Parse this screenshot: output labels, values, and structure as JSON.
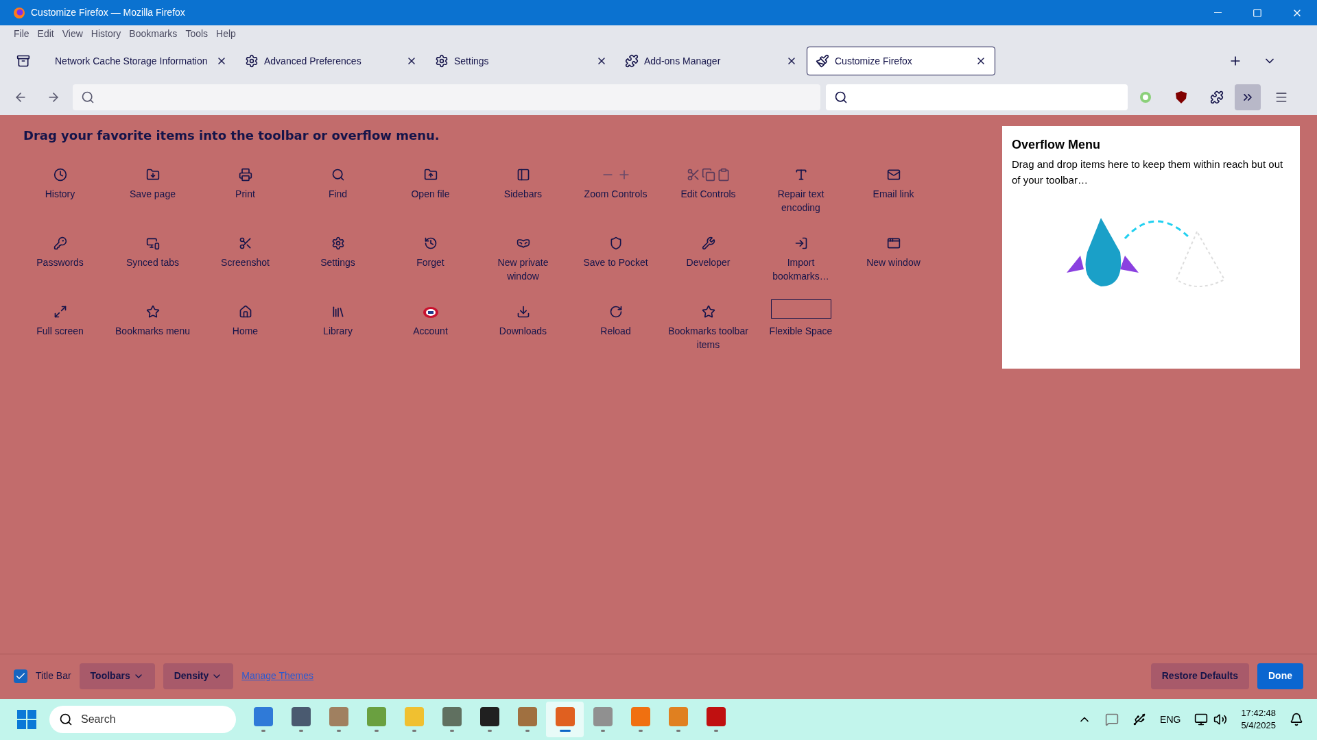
{
  "window": {
    "title": "Customize Firefox — Mozilla Firefox"
  },
  "menu": [
    "File",
    "Edit",
    "View",
    "History",
    "Bookmarks",
    "Tools",
    "Help"
  ],
  "tabs": [
    {
      "label": "Network Cache Storage Information",
      "selected": false
    },
    {
      "label": "Advanced Preferences",
      "selected": false
    },
    {
      "label": "Settings",
      "selected": false
    },
    {
      "label": "Add-ons Manager",
      "selected": false
    },
    {
      "label": "Customize Firefox",
      "selected": true
    }
  ],
  "customize": {
    "heading": "Drag your favorite items into the toolbar or overflow menu.",
    "items": [
      {
        "label": "History",
        "kind": "icon"
      },
      {
        "label": "Save page",
        "kind": "icon"
      },
      {
        "label": "Print",
        "kind": "icon"
      },
      {
        "label": "Find",
        "kind": "icon"
      },
      {
        "label": "Open file",
        "kind": "icon"
      },
      {
        "label": "Sidebars",
        "kind": "icon"
      },
      {
        "label": "Zoom Controls",
        "kind": "icon"
      },
      {
        "label": "Edit Controls",
        "kind": "icon"
      },
      {
        "label": "Repair text encoding",
        "kind": "icon"
      },
      {
        "label": "Email link",
        "kind": "icon"
      },
      {
        "label": "Passwords",
        "kind": "icon"
      },
      {
        "label": "Synced tabs",
        "kind": "icon"
      },
      {
        "label": "Screenshot",
        "kind": "icon"
      },
      {
        "label": "Settings",
        "kind": "icon"
      },
      {
        "label": "Forget",
        "kind": "icon"
      },
      {
        "label": "New private window",
        "kind": "icon"
      },
      {
        "label": "Save to Pocket",
        "kind": "icon"
      },
      {
        "label": "Developer",
        "kind": "icon"
      },
      {
        "label": "Import bookmarks…",
        "kind": "icon"
      },
      {
        "label": "New window",
        "kind": "icon"
      },
      {
        "label": "Full screen",
        "kind": "icon"
      },
      {
        "label": "Bookmarks menu",
        "kind": "icon"
      },
      {
        "label": "Home",
        "kind": "icon"
      },
      {
        "label": "Library",
        "kind": "icon"
      },
      {
        "label": "Account",
        "kind": "icon"
      },
      {
        "label": "Downloads",
        "kind": "icon"
      },
      {
        "label": "Reload",
        "kind": "icon"
      },
      {
        "label": "Bookmarks toolbar items",
        "kind": "icon"
      },
      {
        "label": "Flexible Space",
        "kind": "space"
      }
    ]
  },
  "overflow": {
    "title": "Overflow Menu",
    "text": "Drag and drop items here to keep them within reach but out of your toolbar…"
  },
  "footer": {
    "title_bar": {
      "label": "Title Bar",
      "checked": true
    },
    "toolbars": "Toolbars",
    "density": "Density",
    "manage_themes": "Manage Themes",
    "restore": "Restore Defaults",
    "done": "Done"
  },
  "taskbar": {
    "search_placeholder": "Search",
    "apps": [
      {
        "active": false
      },
      {
        "active": false
      },
      {
        "active": false
      },
      {
        "active": false
      },
      {
        "active": false
      },
      {
        "active": false
      },
      {
        "active": false
      },
      {
        "active": false
      },
      {
        "active": true
      },
      {
        "active": false
      },
      {
        "active": false
      },
      {
        "active": false
      },
      {
        "active": false
      }
    ],
    "language": "ENG",
    "time": "17:42:48",
    "date": "5/4/2025"
  }
}
